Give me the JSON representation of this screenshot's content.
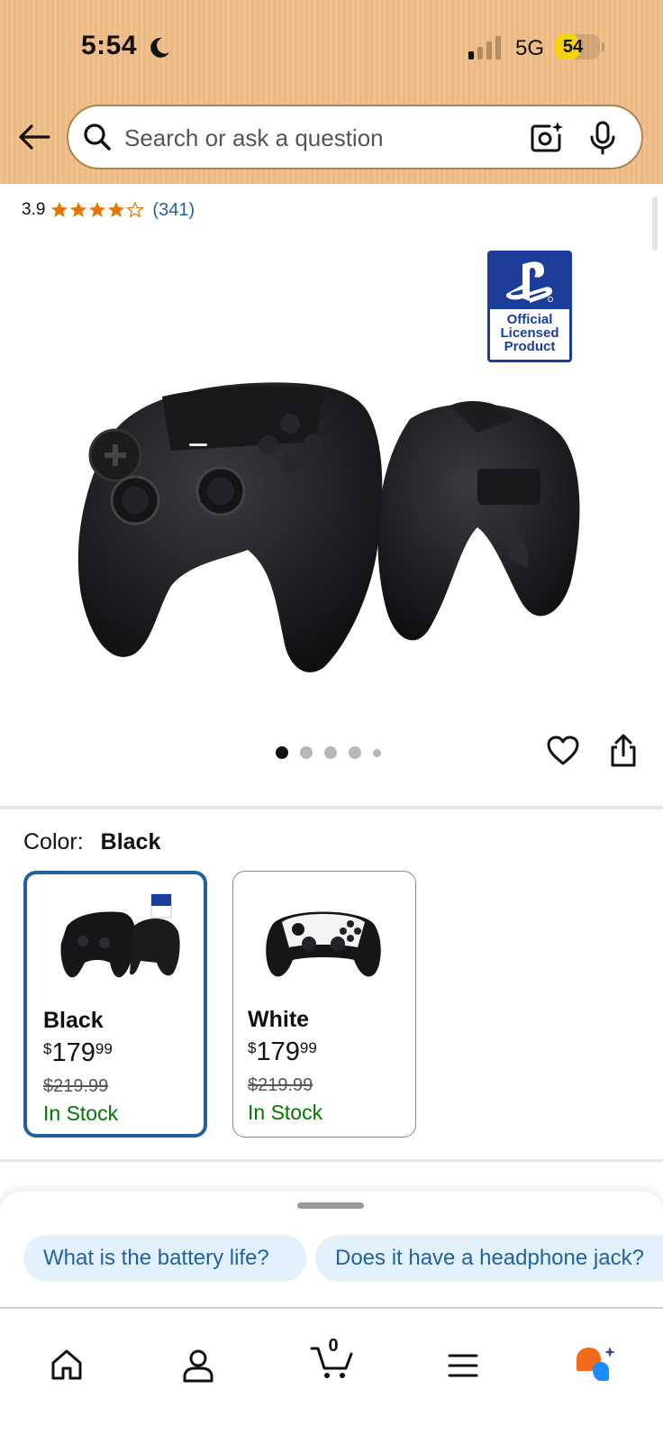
{
  "status_bar": {
    "time": "5:54",
    "network": "5G",
    "battery": "54",
    "battery_level": 0.54
  },
  "header": {
    "search_placeholder": "Search or ask a question",
    "background_color": "#f0bd86"
  },
  "rating": {
    "value": "3.9",
    "stars": 3.9,
    "count": "(341)"
  },
  "gallery": {
    "badge_text": [
      "Official",
      "Licensed",
      "Product"
    ],
    "image_count": 5,
    "active_index": 0
  },
  "color_selector": {
    "label": "Color:",
    "selected": "Black",
    "options": [
      {
        "name": "Black",
        "price_symbol": "$",
        "price_whole": "179",
        "price_cents": "99",
        "list_price": "$219.99",
        "stock": "In Stock",
        "selected": true
      },
      {
        "name": "White",
        "price_symbol": "$",
        "price_whole": "179",
        "price_cents": "99",
        "list_price": "$219.99",
        "stock": "In Stock",
        "selected": false
      }
    ]
  },
  "suggestions": [
    "What is the battery life?",
    "Does it have a headphone jack?"
  ],
  "bottom_nav": {
    "items": [
      "home-icon",
      "account-icon",
      "cart-icon",
      "menu-icon",
      "rufus-icon"
    ],
    "cart_count": "0"
  },
  "colors": {
    "accent_blue": "#2162a1",
    "in_stock_green": "#007600",
    "star_orange": "#e77600",
    "chip_bg": "#e2f1fb"
  }
}
